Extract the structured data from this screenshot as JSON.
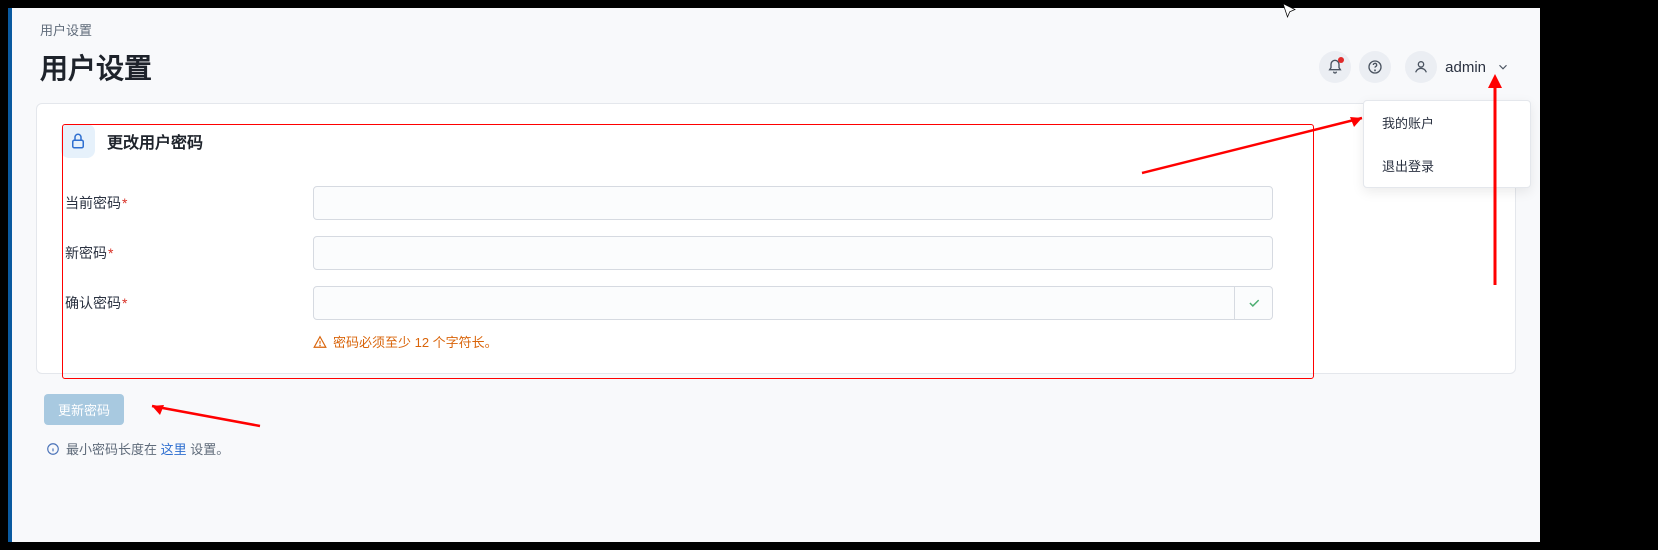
{
  "breadcrumb": "用户设置",
  "page_title": "用户设置",
  "header": {
    "username": "admin",
    "dropdown": {
      "my_account": "我的账户",
      "logout": "退出登录"
    }
  },
  "section": {
    "title": "更改用户密码"
  },
  "form": {
    "current_password": {
      "label": "当前密码",
      "value": ""
    },
    "new_password": {
      "label": "新密码",
      "value": ""
    },
    "confirm_password": {
      "label": "确认密码",
      "value": ""
    },
    "required_mark": "*",
    "warning": "密码必须至少 12 个字符长。"
  },
  "actions": {
    "update_button": "更新密码"
  },
  "hint": {
    "prefix": "最小密码长度在 ",
    "link": "这里",
    "suffix": " 设置。"
  }
}
